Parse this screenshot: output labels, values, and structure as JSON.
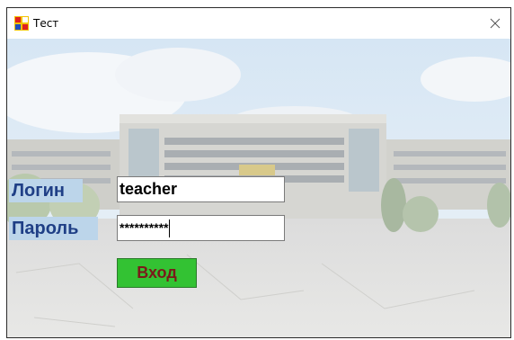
{
  "window": {
    "title": "Тест",
    "app_icon": "app-window-icon",
    "close_icon": "close-icon"
  },
  "form": {
    "login_label": "Логин",
    "login_value": "teacher",
    "password_label": "Пароль",
    "password_mask": "**********",
    "submit_label": "Вход"
  },
  "colors": {
    "label_text": "#1f3f86",
    "label_background": "#bcd5ea",
    "button_background": "#33c233",
    "button_text": "#7a1a1a"
  }
}
